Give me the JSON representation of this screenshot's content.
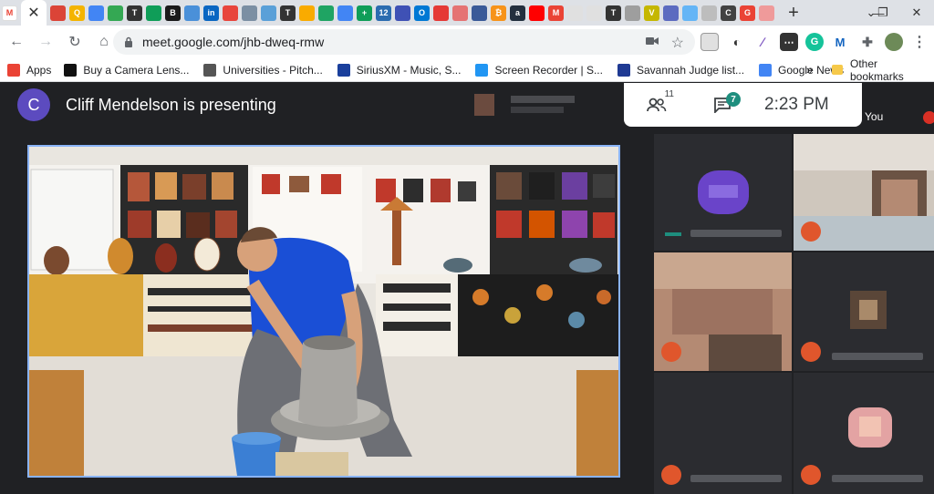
{
  "browser": {
    "tabs": [
      {
        "icon": "gmail-icon",
        "color": "#ea4335",
        "glyph": "M"
      },
      {
        "icon": "tab-icon",
        "color": "#db4437",
        "glyph": ""
      },
      {
        "icon": "tab-icon",
        "color": "#f4b400",
        "glyph": "Q"
      },
      {
        "icon": "tab-icon",
        "color": "#4285f4",
        "glyph": ""
      },
      {
        "icon": "tab-icon",
        "color": "#34a853",
        "glyph": ""
      },
      {
        "icon": "nytimes-icon",
        "color": "#333333",
        "glyph": "T"
      },
      {
        "icon": "tab-icon",
        "color": "#0f9d58",
        "glyph": ""
      },
      {
        "icon": "tab-icon",
        "color": "#1a1a1a",
        "glyph": "B"
      },
      {
        "icon": "tab-icon",
        "color": "#4a90d9",
        "glyph": ""
      },
      {
        "icon": "linkedin-icon",
        "color": "#0a66c2",
        "glyph": "in"
      },
      {
        "icon": "tab-icon",
        "color": "#e8453c",
        "glyph": ""
      },
      {
        "icon": "tab-icon",
        "color": "#7b8fa3",
        "glyph": ""
      },
      {
        "icon": "tab-icon",
        "color": "#5aa0d8",
        "glyph": ""
      },
      {
        "icon": "tab-icon",
        "color": "#333333",
        "glyph": "T"
      },
      {
        "icon": "tab-icon",
        "color": "#f9ab00",
        "glyph": ""
      },
      {
        "icon": "google-drive-icon",
        "color": "#1fa463",
        "glyph": ""
      },
      {
        "icon": "google-docs-icon",
        "color": "#4285f4",
        "glyph": ""
      },
      {
        "icon": "tab-icon",
        "color": "#0f9d58",
        "glyph": "+"
      },
      {
        "icon": "tab-icon",
        "color": "#2b6cb0",
        "glyph": "12"
      },
      {
        "icon": "tab-icon",
        "color": "#3f51b5",
        "glyph": ""
      },
      {
        "icon": "outlook-icon",
        "color": "#0078d4",
        "glyph": "O"
      },
      {
        "icon": "tab-icon",
        "color": "#e53935",
        "glyph": ""
      },
      {
        "icon": "tab-icon",
        "color": "#e57373",
        "glyph": ""
      },
      {
        "icon": "tab-icon",
        "color": "#3a5a98",
        "glyph": ""
      },
      {
        "icon": "bitcoin-icon",
        "color": "#f7931a",
        "glyph": "₿"
      },
      {
        "icon": "amazon-icon",
        "color": "#232f3e",
        "glyph": "a"
      },
      {
        "icon": "youtube-icon",
        "color": "#ff0000",
        "glyph": ""
      },
      {
        "icon": "gmail-icon",
        "color": "#ea4335",
        "glyph": "M"
      },
      {
        "icon": "tab-icon",
        "color": "#e0e0e0",
        "glyph": ""
      },
      {
        "icon": "tab-icon",
        "color": "#e0e0e0",
        "glyph": ""
      },
      {
        "icon": "nytimes-icon",
        "color": "#333333",
        "glyph": "T"
      },
      {
        "icon": "tab-icon",
        "color": "#9e9e9e",
        "glyph": ""
      },
      {
        "icon": "tab-icon",
        "color": "#c5b700",
        "glyph": "V"
      },
      {
        "icon": "tab-icon",
        "color": "#5c6bc0",
        "glyph": ""
      },
      {
        "icon": "tab-icon",
        "color": "#64b5f6",
        "glyph": ""
      },
      {
        "icon": "tab-icon",
        "color": "#bdbdbd",
        "glyph": ""
      },
      {
        "icon": "tab-icon",
        "color": "#424242",
        "glyph": "C"
      },
      {
        "icon": "google-icon",
        "color": "#ea4335",
        "glyph": "G"
      },
      {
        "icon": "tab-icon",
        "color": "#ef9a9a",
        "glyph": ""
      }
    ],
    "active_tab_close": "✕",
    "new_tab": "+",
    "url": "meet.google.com/jhb-dweq-rmw",
    "back": "←",
    "forward": "→",
    "reload": "↻",
    "home": "⌂",
    "star": "☆",
    "menu": "⋮",
    "minimize": "—",
    "restore": "❐",
    "close": "✕"
  },
  "bookmarks": {
    "items": [
      {
        "label": "Apps",
        "color": "#ea4335"
      },
      {
        "label": "Buy a Camera Lens...",
        "color": "#111111"
      },
      {
        "label": "Universities - Pitch...",
        "color": "#555555"
      },
      {
        "label": "SiriusXM - Music, S...",
        "color": "#1a3f9c"
      },
      {
        "label": "Screen Recorder | S...",
        "color": "#2196f3"
      },
      {
        "label": "Savannah Judge list...",
        "color": "#1f3a93"
      },
      {
        "label": "Google News",
        "color": "#4285f4"
      }
    ],
    "overflow": "»",
    "other": "Other bookmarks"
  },
  "meet": {
    "presenter_initial": "C",
    "presenter_text": "Cliff Mendelson is presenting",
    "participants_count": "11",
    "chat_count": "7",
    "time": "2:23  PM",
    "you_label": "You"
  },
  "colors": {
    "accent": "#8ab4f8",
    "meet_bg": "#202124",
    "badge": "#1e8e7e",
    "muted": "#e0562c"
  }
}
